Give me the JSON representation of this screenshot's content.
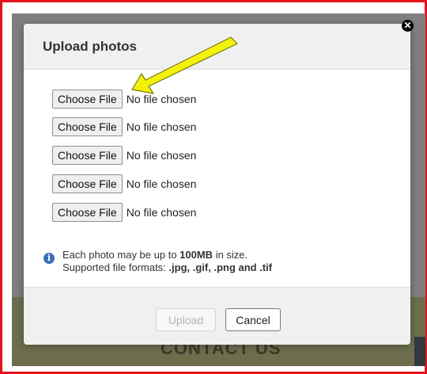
{
  "dialog": {
    "title": "Upload photos",
    "close_icon": "close-icon"
  },
  "file_inputs": [
    {
      "button_label": "Choose File",
      "status": "No file chosen"
    },
    {
      "button_label": "Choose File",
      "status": "No file chosen"
    },
    {
      "button_label": "Choose File",
      "status": "No file chosen"
    },
    {
      "button_label": "Choose File",
      "status": "No file chosen"
    },
    {
      "button_label": "Choose File",
      "status": "No file chosen"
    }
  ],
  "info": {
    "icon": "info-icon",
    "line1_prefix": "Each photo may be up to ",
    "line1_bold": "100MB",
    "line1_suffix": " in size.",
    "line2_prefix": "Supported file formats: ",
    "line2_bold": ".jpg, .gif, .png and .tif"
  },
  "footer": {
    "upload_label": "Upload",
    "upload_disabled": true,
    "cancel_label": "Cancel"
  },
  "background": {
    "contact_text": "CONTACT US"
  },
  "annotation": {
    "arrow_color": "#f2f20a",
    "frame_color": "#e3141b"
  }
}
